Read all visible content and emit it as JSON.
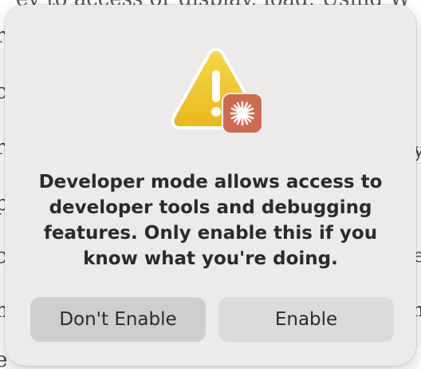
{
  "dialog": {
    "message": "Developer mode allows access to developer tools and debugging features. Only enable this if you know what you're doing.",
    "buttons": {
      "cancel_label": "Don't Enable",
      "confirm_label": "Enable"
    },
    "icons": {
      "main": "warning-triangle-icon",
      "badge": "app-burst-icon"
    },
    "colors": {
      "warning": "#f0c419",
      "badge": "#d06a4e",
      "dialog_bg": "#ecebea"
    }
  },
  "background": {
    "top_line": "ey to access or display, load, Using W"
  }
}
